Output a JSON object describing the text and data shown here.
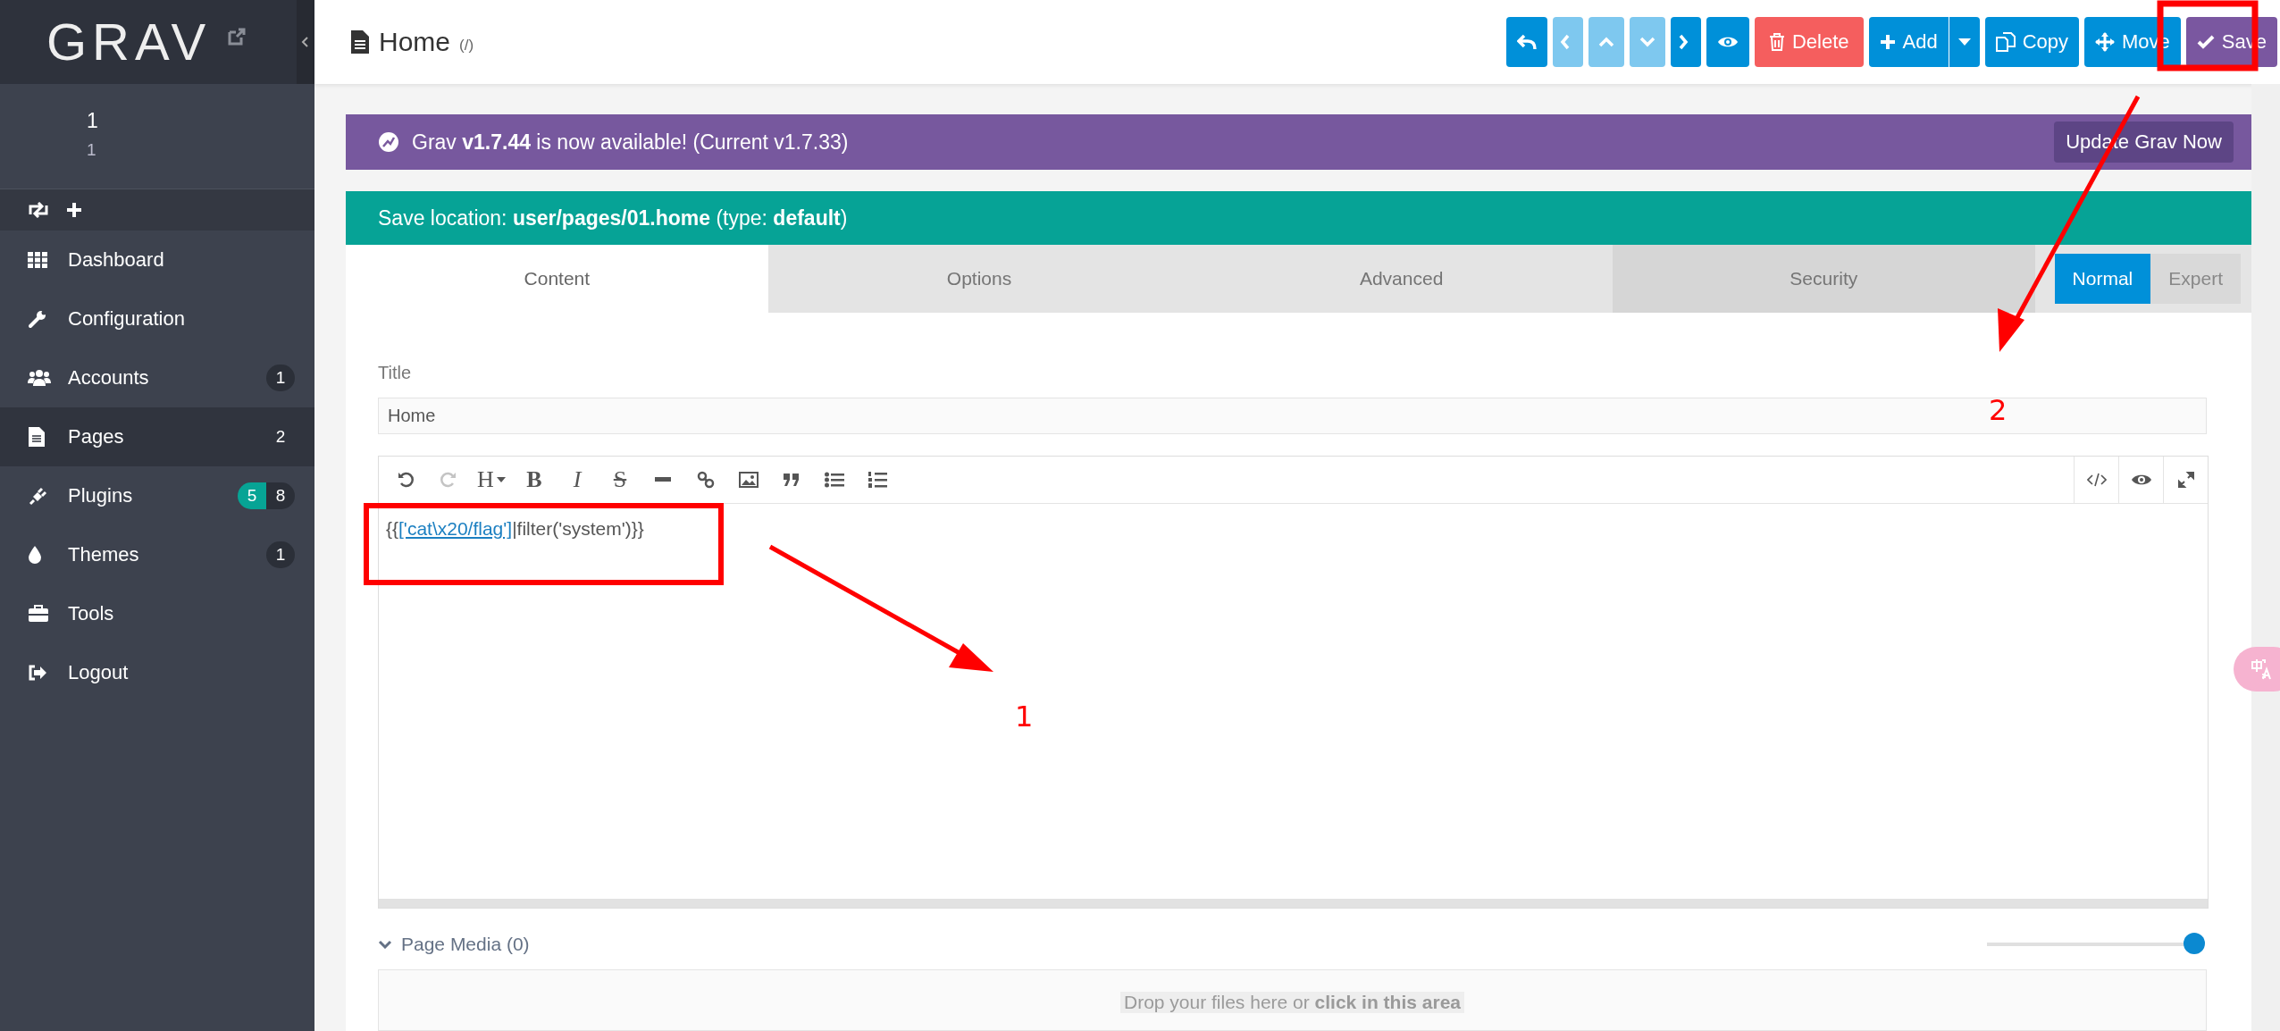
{
  "sidebar": {
    "logo": "GRAV",
    "user": {
      "name": "1",
      "email": "1"
    },
    "items": [
      {
        "kind": "dashboard",
        "label": "Dashboard",
        "selected": false
      },
      {
        "kind": "configuration",
        "label": "Configuration",
        "selected": false
      },
      {
        "kind": "accounts",
        "label": "Accounts",
        "selected": false,
        "badges": [
          {
            "text": "1",
            "color": "#2b2f38"
          }
        ]
      },
      {
        "kind": "pages",
        "label": "Pages",
        "selected": true,
        "badges": [
          {
            "text": "2"
          }
        ]
      },
      {
        "kind": "plugins",
        "label": "Plugins",
        "selected": false,
        "badges": [
          {
            "text": "5",
            "color": "#07a495"
          },
          {
            "text": "8",
            "color": "#2b2f38"
          }
        ]
      },
      {
        "kind": "themes",
        "label": "Themes",
        "selected": false,
        "badges": [
          {
            "text": "1",
            "color": "#2b2f38"
          }
        ]
      },
      {
        "kind": "tools",
        "label": "Tools",
        "selected": false
      },
      {
        "kind": "logout",
        "label": "Logout",
        "selected": false
      }
    ]
  },
  "header": {
    "title": "Home",
    "route": "(/)",
    "toolbar": [
      {
        "kind": "back",
        "disabled": false
      },
      {
        "kind": "prev",
        "disabled": true
      },
      {
        "kind": "up",
        "disabled": true
      },
      {
        "kind": "down",
        "disabled": true
      },
      {
        "kind": "next",
        "disabled": false
      },
      {
        "kind": "preview",
        "disabled": false
      },
      {
        "kind": "delete",
        "label": "Delete",
        "disabled": false
      },
      {
        "kind": "add",
        "label": "Add",
        "disabled": false
      },
      {
        "kind": "copy",
        "label": "Copy",
        "disabled": false
      },
      {
        "kind": "move",
        "label": "Move",
        "disabled": false
      },
      {
        "kind": "save",
        "label": "Save",
        "disabled": false
      }
    ]
  },
  "update_banner": {
    "text": "Grav **v1.7.44** is now available! (Current v1.7.33)",
    "button": "Update Grav Now"
  },
  "save_location": "Save location: **user/pages/01.home** (type: **default**)",
  "tabs": [
    {
      "label": "Content",
      "selected": true,
      "hovered": false
    },
    {
      "label": "Options",
      "selected": false,
      "hovered": false
    },
    {
      "label": "Advanced",
      "selected": false,
      "hovered": false
    },
    {
      "label": "Security",
      "selected": false,
      "hovered": true
    }
  ],
  "mode": [
    {
      "label": "Normal",
      "selected": true
    },
    {
      "label": "Expert",
      "selected": false
    }
  ],
  "title_field": {
    "label": "Title",
    "value": "Home"
  },
  "editor": {
    "toolbar": [
      {
        "kind": "undo",
        "disabled": false
      },
      {
        "kind": "redo",
        "disabled": true
      },
      {
        "kind": "heading",
        "label": "H",
        "disabled": false
      },
      {
        "kind": "bold",
        "label": "B",
        "disabled": false
      },
      {
        "kind": "italic",
        "label": "I",
        "disabled": false
      },
      {
        "kind": "strike",
        "label": "S",
        "disabled": false
      },
      {
        "kind": "rule",
        "disabled": false
      },
      {
        "kind": "link",
        "disabled": false
      },
      {
        "kind": "image",
        "disabled": false
      },
      {
        "kind": "quote",
        "disabled": false
      },
      {
        "kind": "bullets",
        "disabled": false
      },
      {
        "kind": "numbers",
        "disabled": false
      }
    ],
    "right_toolbar": [
      {
        "kind": "code"
      },
      {
        "kind": "preview"
      },
      {
        "kind": "fullscreen"
      }
    ],
    "content": {
      "before": "{{",
      "link": "['cat\\x20/flag']",
      "after": "|filter('system')}}"
    }
  },
  "page_media": {
    "title": "Page Media (0)",
    "expanded": true,
    "level": 1,
    "dropzone": "Drop your files here or **click in this area**"
  },
  "annotations": [
    "1",
    "2"
  ]
}
